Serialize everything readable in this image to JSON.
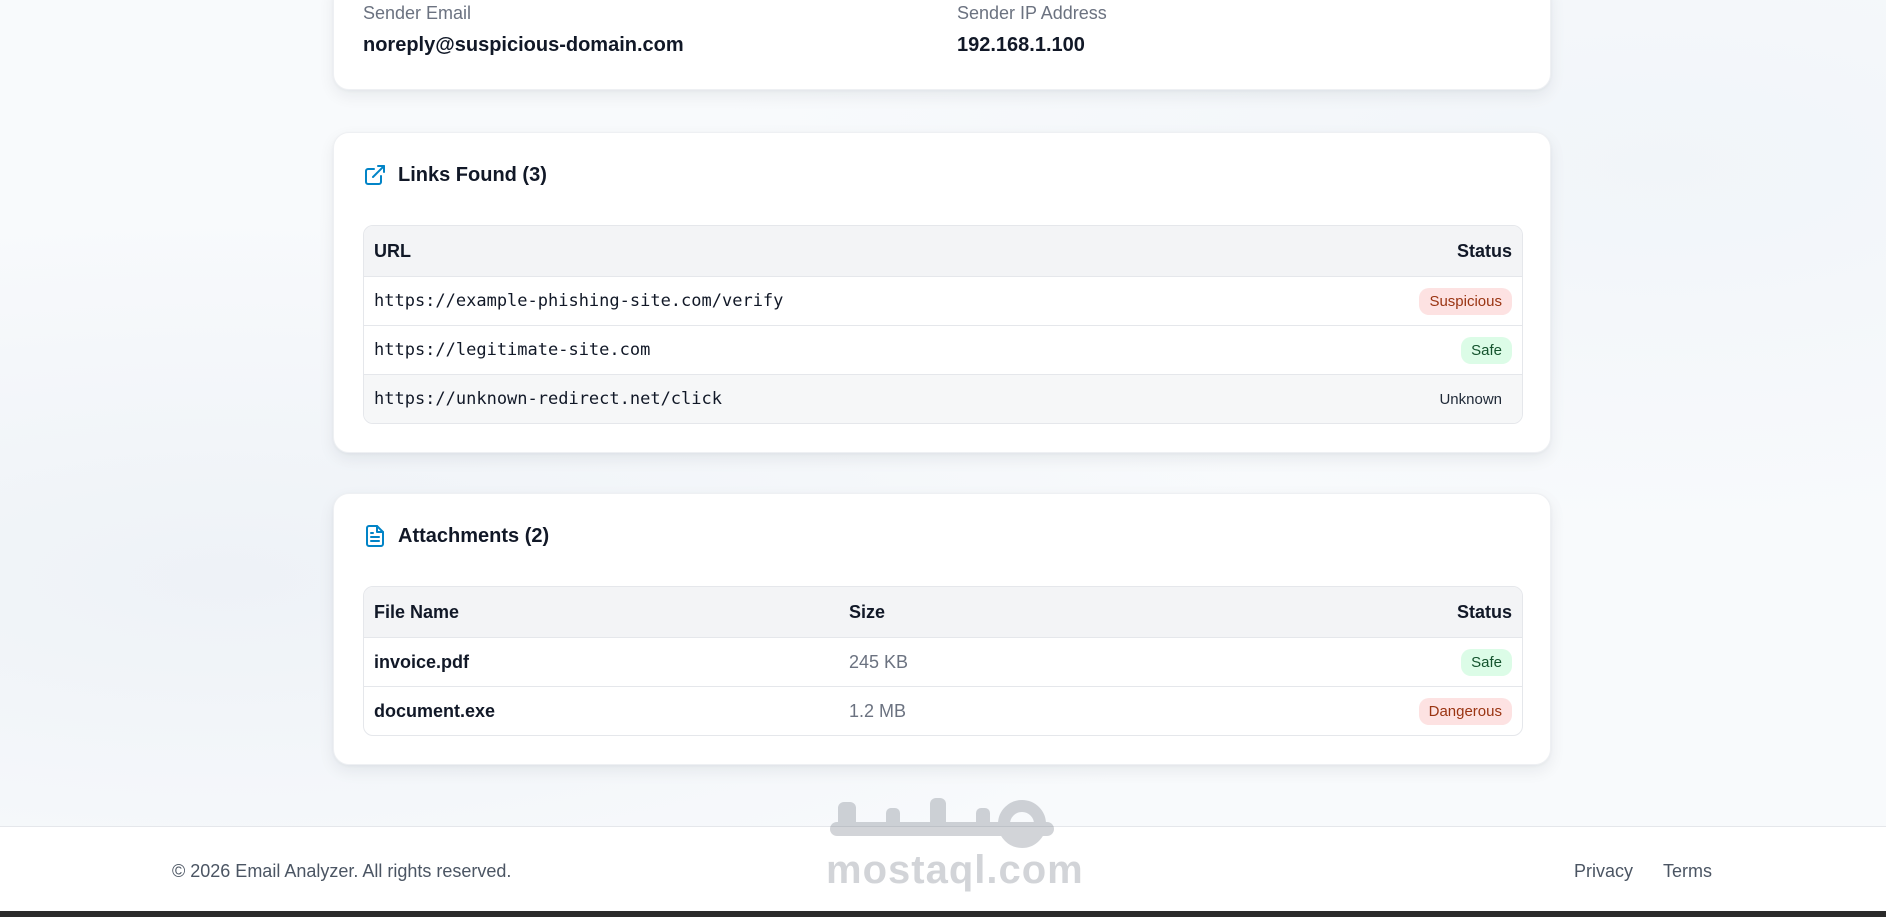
{
  "sender": {
    "email_label": "Sender Email",
    "email_value": "noreply@suspicious-domain.com",
    "ip_label": "Sender IP Address",
    "ip_value": "192.168.1.100"
  },
  "links": {
    "icon": "external-link-icon",
    "title": "Links Found (3)",
    "headers": {
      "url": "URL",
      "status": "Status"
    },
    "rows": [
      {
        "url": "https://example-phishing-site.com/verify",
        "status": "Suspicious"
      },
      {
        "url": "https://legitimate-site.com",
        "status": "Safe"
      },
      {
        "url": "https://unknown-redirect.net/click",
        "status": "Unknown"
      }
    ]
  },
  "attachments": {
    "icon": "file-text-icon",
    "title": "Attachments (2)",
    "headers": {
      "file": "File Name",
      "size": "Size",
      "status": "Status"
    },
    "rows": [
      {
        "file": "invoice.pdf",
        "size": "245 KB",
        "status": "Safe"
      },
      {
        "file": "document.exe",
        "size": "1.2 MB",
        "status": "Dangerous"
      }
    ]
  },
  "footer": {
    "copyright": "© 2026 Email Analyzer. All rights reserved.",
    "links": [
      "Privacy",
      "Terms"
    ]
  },
  "watermark": {
    "logo_text": "مستقل",
    "text": "mostaql.com"
  },
  "colors": {
    "accent": "#0284c7",
    "danger_bg": "#fde2e2",
    "danger_text": "#9a3412",
    "safe_bg": "#dcfce7",
    "safe_text": "#14532d"
  }
}
